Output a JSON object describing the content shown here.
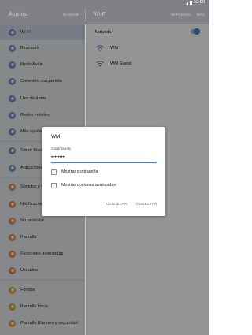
{
  "statusbar": {
    "time": "10:00",
    "icons": [
      "signal-icon",
      "battery-icon"
    ]
  },
  "header": {
    "settings_title": "Ajustes",
    "search_label": "BUSCAR",
    "wifi_title": "Wi-Fi",
    "wifi_direct_label": "Wi-Fi Direct",
    "more_label": "MÁS"
  },
  "sidebar": {
    "items": [
      {
        "label": "Wi-Fi",
        "icon": "wifi-icon",
        "color": "#6f8fca",
        "selected": true
      },
      {
        "label": "Bluetooth",
        "icon": "bluetooth-icon",
        "color": "#6f8fca"
      },
      {
        "label": "Modo Avión",
        "icon": "airplane-icon",
        "color": "#6f8fca"
      },
      {
        "label": "Conexión compartida",
        "icon": "tethering-icon",
        "color": "#6f8fca"
      },
      {
        "label": "Uso de datos",
        "icon": "data-usage-icon",
        "color": "#6f8fca"
      },
      {
        "label": "Redes móviles",
        "icon": "mobile-networks-icon",
        "color": "#6f8fca"
      },
      {
        "label": "Más ajustes",
        "icon": "more-settings-icon",
        "color": "#6f8fca"
      },
      {
        "label": "Smart Manager",
        "icon": "smart-manager-icon",
        "color": "#6f8fca"
      },
      {
        "label": "Aplicaciones",
        "icon": "apps-icon",
        "color": "#6f8fca"
      },
      {
        "label": "Sonidos y vibración",
        "icon": "sound-icon",
        "color": "#e08a4e"
      },
      {
        "label": "Notificaciones",
        "icon": "notifications-icon",
        "color": "#e08a4e"
      },
      {
        "label": "No molestar",
        "icon": "do-not-disturb-icon",
        "color": "#e08a4e"
      },
      {
        "label": "Pantalla",
        "icon": "display-icon",
        "color": "#e08a4e"
      },
      {
        "label": "Funciones avanzadas",
        "icon": "advanced-features-icon",
        "color": "#e08a4e"
      },
      {
        "label": "Usuarios",
        "icon": "users-icon",
        "color": "#e08a4e"
      },
      {
        "label": "Fondos",
        "icon": "wallpaper-icon",
        "color": "#d9a23e"
      },
      {
        "label": "Pantalla Inicio",
        "icon": "home-screen-icon",
        "color": "#d9a23e"
      },
      {
        "label": "Pantalla Bloqueo y seguridad",
        "icon": "lock-screen-icon",
        "color": "#d9a23e"
      }
    ]
  },
  "wifi_panel": {
    "activated_label": "Activada",
    "networks": [
      {
        "name": "WM"
      },
      {
        "name": "WM Guest"
      }
    ]
  },
  "dialog": {
    "title": "WM",
    "password_label": "Contraseña",
    "password_value": "••••••••",
    "show_password_label": "Mostrar contraseña",
    "show_advanced_label": "Mostrar opciones avanzadas",
    "cancel_label": "CANCELAR",
    "connect_label": "CONECTAR"
  },
  "colors": {
    "accent": "#4a7cc7",
    "header_bg": "#7f8187"
  }
}
